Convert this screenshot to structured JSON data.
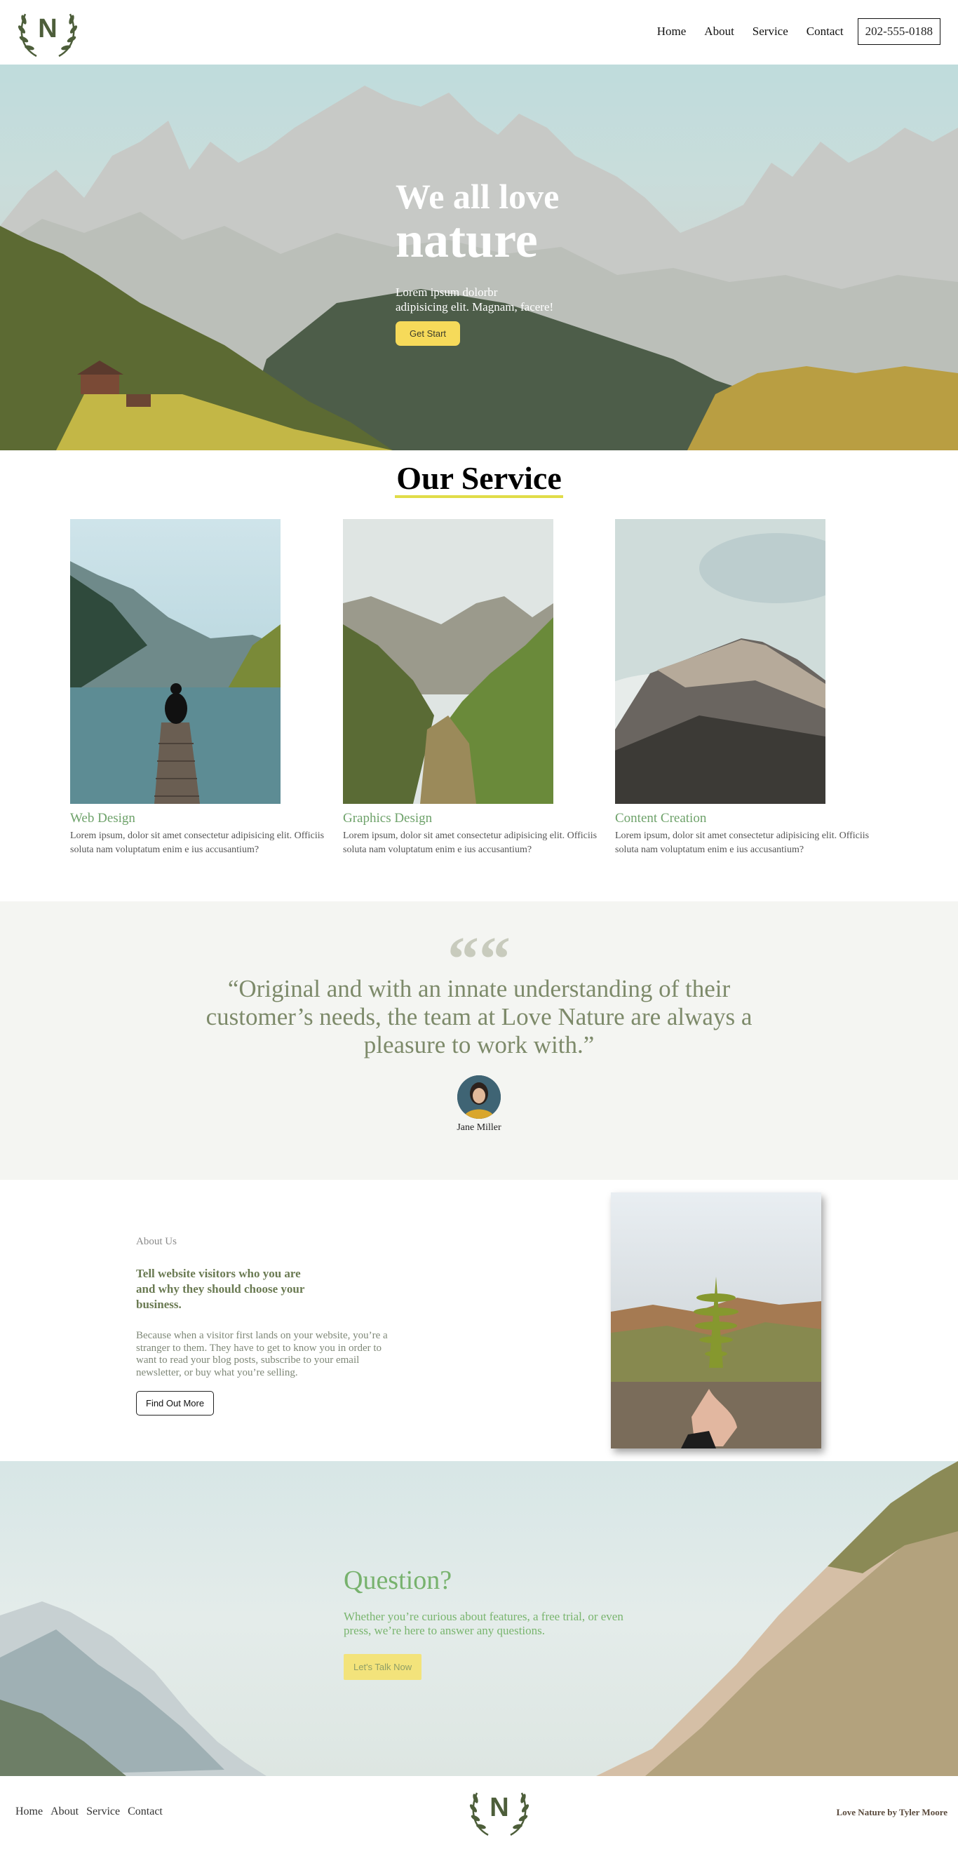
{
  "brand": {
    "logo_letter": "N"
  },
  "nav": {
    "items": [
      "Home",
      "About",
      "Service",
      "Contact"
    ],
    "phone": "202-555-0188"
  },
  "hero": {
    "title_line1": "We all love",
    "title_line2": "nature",
    "subtitle_line1": "Lorem ipsum dolorbr",
    "subtitle_line2": "adipisicing elit. Magnam, facere!",
    "button": "Get Start"
  },
  "services": {
    "title": "Our Service",
    "cards": [
      {
        "name": "Web Design",
        "desc": "Lorem ipsum, dolor sit amet consectetur adipisicing elit. Officiis soluta nam voluptatum enim e ius accusantium?"
      },
      {
        "name": "Graphics Design",
        "desc": "Lorem ipsum, dolor sit amet consectetur adipisicing elit. Officiis soluta nam voluptatum enim e ius accusantium?"
      },
      {
        "name": "Content Creation",
        "desc": "Lorem ipsum, dolor sit amet consectetur adipisicing elit. Officiis soluta nam voluptatum enim e ius accusantium?"
      }
    ]
  },
  "testimonial": {
    "quote_mark": "““",
    "quote": "“Original and with an innate understanding of their customer’s needs, the team at Love Nature are always a pleasure to work with.”",
    "author": "Jane Miller"
  },
  "about": {
    "kicker": "About Us",
    "heading": "Tell website visitors who you are and why they should choose your business.",
    "body": "Because when a visitor first lands on your website, you’re a stranger to them. They have to get to know you in order to want to read your blog posts, subscribe to your email newsletter, or buy what you’re selling.",
    "button": "Find Out More"
  },
  "cta": {
    "title": "Question?",
    "text": "Whether you’re curious about features, a free trial, or even press, we’re here to answer any questions.",
    "button": "Let's Talk Now"
  },
  "footer": {
    "items": [
      "Home",
      "About",
      "Service",
      "Contact"
    ],
    "credit": "Love Nature by Tyler Moore"
  },
  "colors": {
    "accent_green": "#6ea26a",
    "button_yellow": "#f6da5a",
    "underline_yellow": "#e0dc48",
    "logo_green": "#4d5e3a"
  }
}
